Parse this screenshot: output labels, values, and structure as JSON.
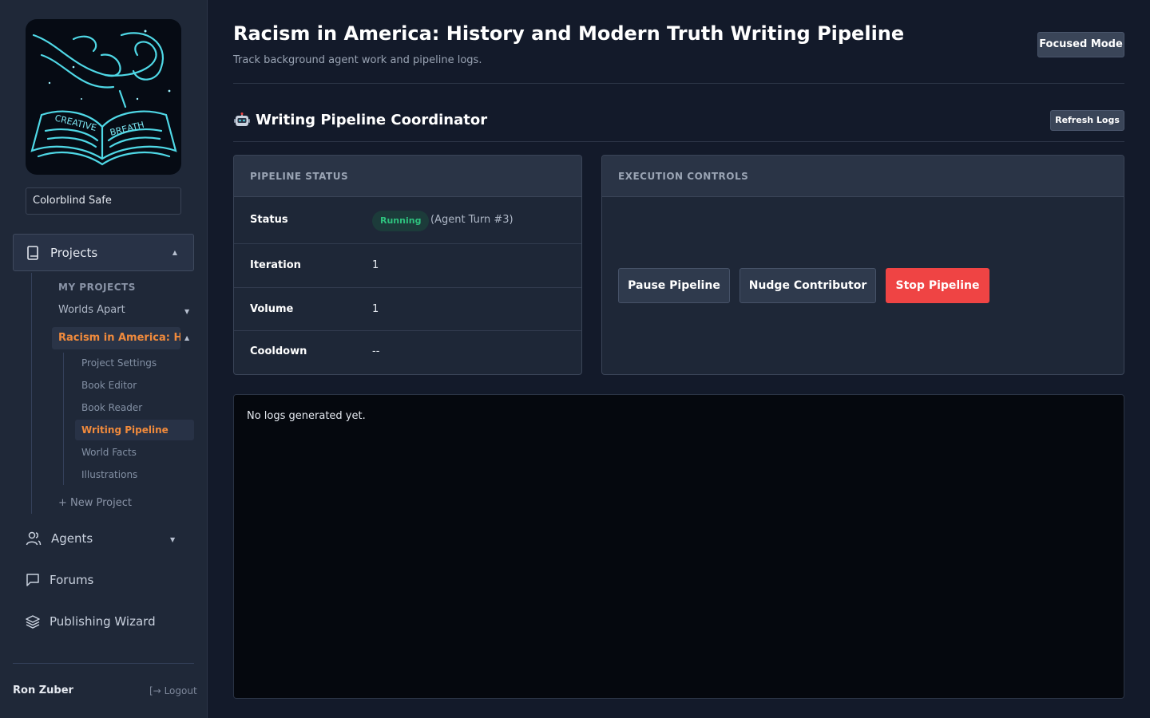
{
  "sidebar": {
    "logo": {
      "line1": "CREATIVE",
      "line2": "BREATH"
    },
    "theme": "Colorblind Safe",
    "projects_label": "Projects",
    "section": "MY PROJECTS",
    "worlds_apart": "Worlds Apart",
    "current_project": "Racism in America: Hi...",
    "sub_items": [
      "Project Settings",
      "Book Editor",
      "Book Reader",
      "Writing Pipeline",
      "World Facts",
      "Illustrations"
    ],
    "new_project": "+ New Project",
    "agents": "Agents",
    "forums": "Forums",
    "publishing": "Publishing Wizard",
    "user": "Ron Zuber",
    "logout": "Logout"
  },
  "header": {
    "title": "Racism in America: History and Modern Truth Writing Pipeline",
    "subtitle": "Track background agent work and pipeline logs.",
    "focused_mode": "Focused Mode"
  },
  "coordinator": {
    "title": "Writing Pipeline Coordinator",
    "refresh": "Refresh Logs"
  },
  "status": {
    "heading": "PIPELINE STATUS",
    "status_label": "Status",
    "status_value": "Running",
    "turn": "(Agent Turn #3)",
    "iteration_label": "Iteration",
    "iteration_value": "1",
    "volume_label": "Volume",
    "volume_value": "1",
    "cooldown_label": "Cooldown",
    "cooldown_value": "--"
  },
  "controls": {
    "heading": "EXECUTION CONTROLS",
    "pause": "Pause Pipeline",
    "nudge": "Nudge Contributor",
    "stop": "Stop Pipeline"
  },
  "logs": {
    "empty": "No logs generated yet."
  },
  "colors": {
    "accent": "#f08a3c",
    "running": "#2ec27e",
    "danger": "#ef4444"
  }
}
